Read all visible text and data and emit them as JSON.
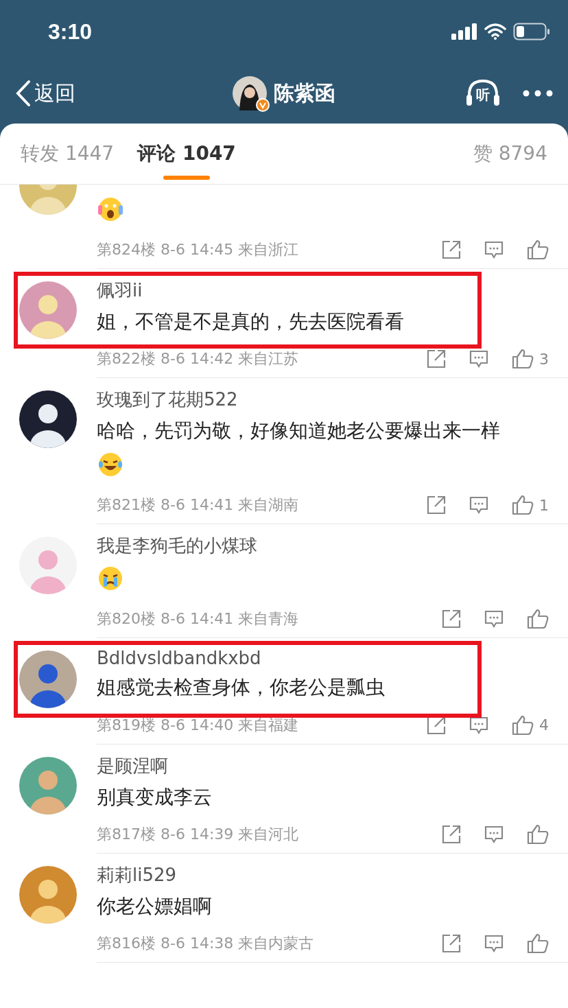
{
  "status_bar": {
    "time": "3:10"
  },
  "nav": {
    "back": "返回",
    "title": "陈紫函",
    "verified": true,
    "listen": "听"
  },
  "tabs": [
    {
      "label": "转发 1447",
      "selected": false
    },
    {
      "label": "评论 1047",
      "selected": true
    },
    {
      "label": "赞 8794",
      "selected": false
    }
  ],
  "comments": [
    {
      "emoji": {
        "kind": "shock"
      },
      "meta": "第824楼 8-6 14:45 来自浙江",
      "highlighted": false
    },
    {
      "name": "佩羽ii",
      "text": "姐，不管是不是真的，先去医院看看",
      "meta": "第822楼 8-6 14:42 来自江苏",
      "likes": "3",
      "highlighted": true
    },
    {
      "name": "玫瑰到了花期522",
      "text": "哈哈，先罚为敬，好像知道她老公要爆出来一样",
      "emoji": {
        "kind": "laugh-cry"
      },
      "meta": "第821楼 8-6 14:41 来自湖南",
      "likes": "1",
      "highlighted": false
    },
    {
      "name": "我是李狗毛的小煤球",
      "emoji": {
        "kind": "cry"
      },
      "meta": "第820楼 8-6 14:41 来自青海",
      "highlighted": false
    },
    {
      "name": "Bdldvsldbandkxbd",
      "text": "姐感觉去检查身体，你老公是瓢虫",
      "meta": "第819楼 8-6 14:40 来自福建",
      "likes": "4",
      "highlighted": true
    },
    {
      "name": "是顾涅啊",
      "text": "别真变成李云",
      "meta": "第817楼 8-6 14:39 来自河北",
      "highlighted": false
    },
    {
      "name": "莉莉li529",
      "text": "你老公嫖娼啊",
      "meta": "第816楼 8-6 14:38 来自内蒙古",
      "highlighted": false
    }
  ]
}
